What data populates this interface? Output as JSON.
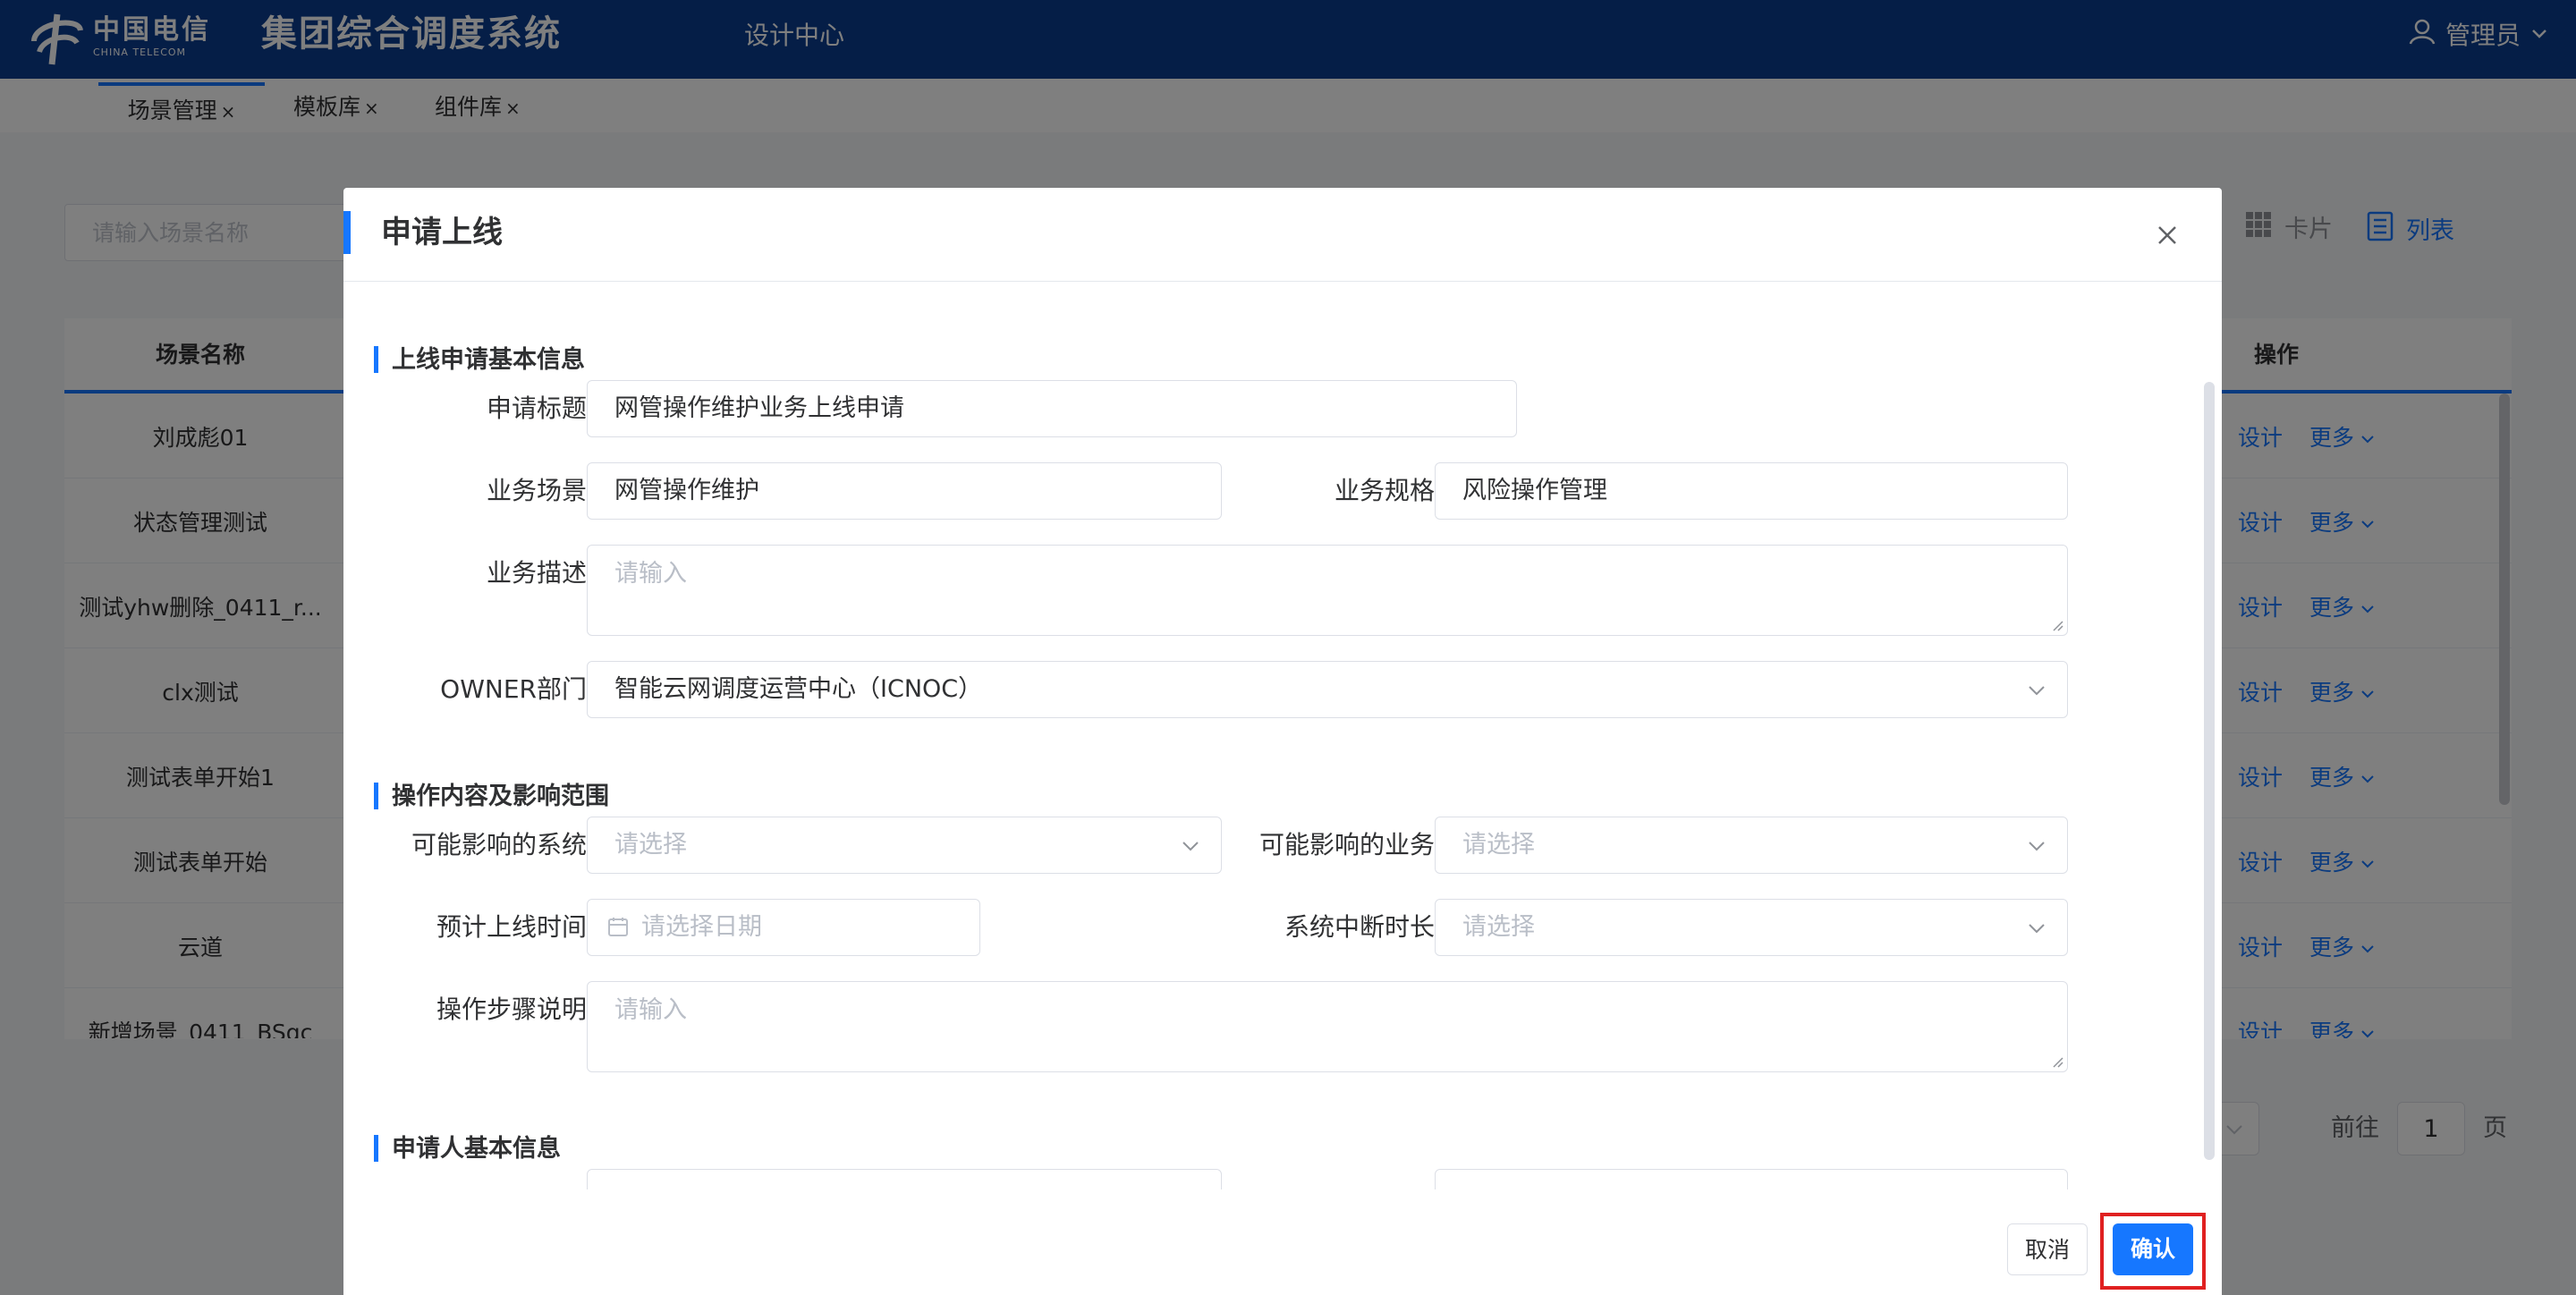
{
  "app": {
    "logo_cn": "中国电信",
    "logo_en": "CHINA TELECOM",
    "system_title": "集团综合调度系统",
    "nav_item": "设计中心",
    "user_name": "管理员"
  },
  "tabs": [
    {
      "label": "场景管理",
      "close": "×"
    },
    {
      "label": "模板库",
      "close": "×"
    },
    {
      "label": "组件库",
      "close": "×"
    }
  ],
  "background": {
    "search_placeholder": "请输入场景名称",
    "view_card": "卡片",
    "view_list": "列表",
    "col_name": "场景名称",
    "col_ops": "操作",
    "rows": [
      "刘成彪01",
      "状态管理测试",
      "测试yhw删除_0411_r...",
      "clx测试",
      "测试表单开始1",
      "测试表单开始",
      "云道",
      "新增场景_0411_BSqc"
    ],
    "op_design": "设计",
    "op_more": "更多",
    "goto_label": "前往",
    "page_value": "1",
    "page_unit": "页"
  },
  "dialog": {
    "title": "申请上线",
    "sections": {
      "basic": "上线申请基本信息",
      "scope": "操作内容及影响范围",
      "applicant": "申请人基本信息"
    },
    "fields": {
      "title_label": "申请标题",
      "title_value": "网管操作维护业务上线申请",
      "scene_label": "业务场景",
      "scene_value": "网管操作维护",
      "spec_label": "业务规格",
      "spec_value": "风险操作管理",
      "desc_label": "业务描述",
      "desc_placeholder": "请输入",
      "owner_label": "OWNER部门",
      "owner_value": "智能云网调度运营中心（ICNOC）",
      "sys_label": "可能影响的系统",
      "sys_placeholder": "请选择",
      "biz_label": "可能影响的业务",
      "biz_placeholder": "请选择",
      "time_label": "预计上线时间",
      "time_placeholder": "请选择日期",
      "outage_label": "系统中断时长",
      "outage_placeholder": "请选择",
      "steps_label": "操作步骤说明",
      "steps_placeholder": "请输入"
    },
    "cancel_label": "取消",
    "confirm_label": "确认"
  },
  "colors": {
    "header_bg": "#0a3d8f",
    "primary": "#1677ff",
    "highlight": "#e02020"
  }
}
